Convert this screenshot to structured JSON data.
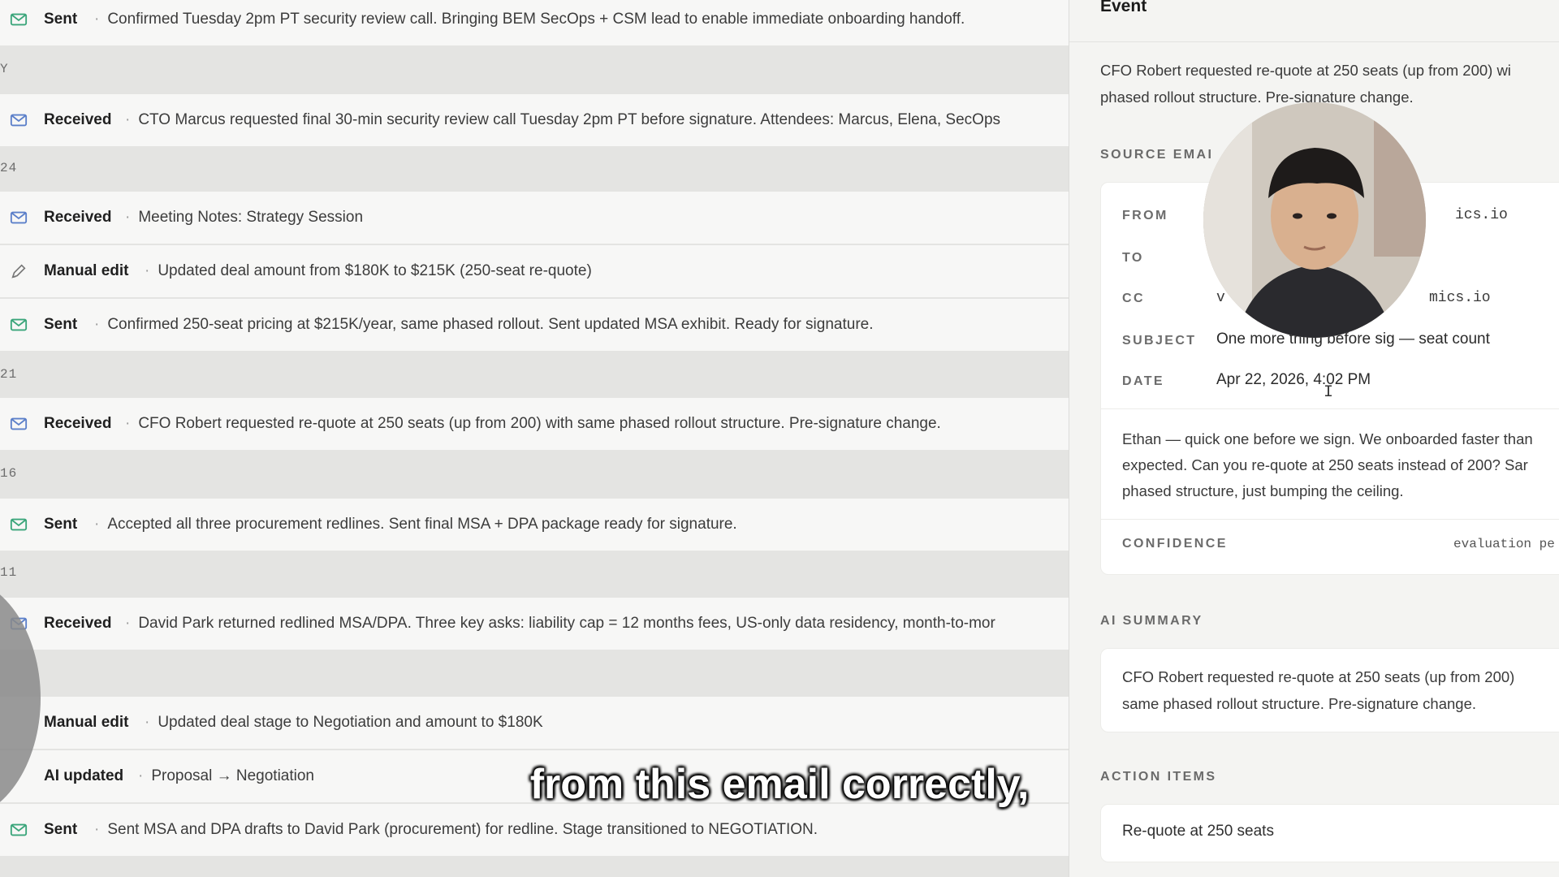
{
  "timeline": {
    "rows": [
      {
        "kind": "Sent",
        "icon": "mail-icon",
        "desc": "Confirmed Tuesday 2pm PT security review call. Bringing BEM SecOps + CSM lead to enable immediate onboarding handoff."
      },
      {
        "kind": "Received",
        "icon": "mail-icon",
        "desc": "CTO Marcus requested final 30-min security review call Tuesday 2pm PT before signature. Attendees: Marcus, Elena, SecOps"
      },
      {
        "kind": "Received",
        "icon": "mail-icon",
        "desc": "Meeting Notes: Strategy Session"
      },
      {
        "kind": "Manual edit",
        "icon": "pencil-icon",
        "desc": "Updated deal amount from $180K to $215K (250-seat re-quote)"
      },
      {
        "kind": "Sent",
        "icon": "mail-icon",
        "desc": "Confirmed 250-seat pricing at $215K/year, same phased rollout. Sent updated MSA exhibit. Ready for signature."
      },
      {
        "kind": "Received",
        "icon": "mail-icon",
        "desc": "CFO Robert requested re-quote at 250 seats (up from 200) with same phased rollout structure. Pre-signature change."
      },
      {
        "kind": "Sent",
        "icon": "mail-icon",
        "desc": "Accepted all three procurement redlines. Sent final MSA + DPA package ready for signature."
      },
      {
        "kind": "Received",
        "icon": "mail-icon",
        "desc": "David Park returned redlined MSA/DPA. Three key asks: liability cap = 12 months fees, US-only data residency, month-to-mor"
      },
      {
        "kind": "Manual edit",
        "icon": "none",
        "desc": "Updated deal stage to Negotiation and amount to $180K"
      },
      {
        "kind": "AI updated",
        "icon": "none",
        "desc": "Proposal → Negotiation"
      },
      {
        "kind": "Sent",
        "icon": "mail-icon",
        "desc": "Sent MSA and DPA drafts to David Park (procurement) for redline. Stage transitioned to NEGOTIATION."
      }
    ],
    "date_labels": [
      "Y",
      "24",
      "21",
      "16",
      "11"
    ],
    "separator": "·"
  },
  "panel": {
    "title": "Event",
    "summary_line1": "CFO Robert requested re-quote at 250 seats (up from 200) wi",
    "summary_line2": "phased rollout structure. Pre-signature change.",
    "source_email_label": "SOURCE EMAI",
    "email": {
      "from_label": "FROM",
      "from_value": "ics.io",
      "to_label": "TO",
      "cc_label": "CC",
      "cc_value_left": "v",
      "cc_value_right": "mics.io",
      "subject_label": "SUBJECT",
      "subject_value": "One more thing before sig — seat count",
      "date_label": "DATE",
      "date_value": "Apr 22, 2026, 4:02 PM",
      "body_line1": "Ethan — quick one before we sign. We onboarded faster than",
      "body_line2": "expected. Can you re-quote at 250 seats instead of 200? Sar",
      "body_line3": "phased structure, just bumping the ceiling.",
      "confidence_label": "CONFIDENCE",
      "confidence_value": "evaluation pe"
    },
    "ai_summary_label": "AI SUMMARY",
    "ai_summary_line1": "CFO Robert requested re-quote at 250 seats (up from 200)",
    "ai_summary_line2": "same phased rollout structure. Pre-signature change.",
    "action_items_label": "ACTION ITEMS",
    "action_items": [
      "Re-quote at 250 seats"
    ]
  },
  "caption": "from this email correctly,",
  "colors": {
    "mail_icon": "#5b7fc9",
    "sent_icon": "#3aa57a",
    "pencil_icon": "#777777"
  }
}
